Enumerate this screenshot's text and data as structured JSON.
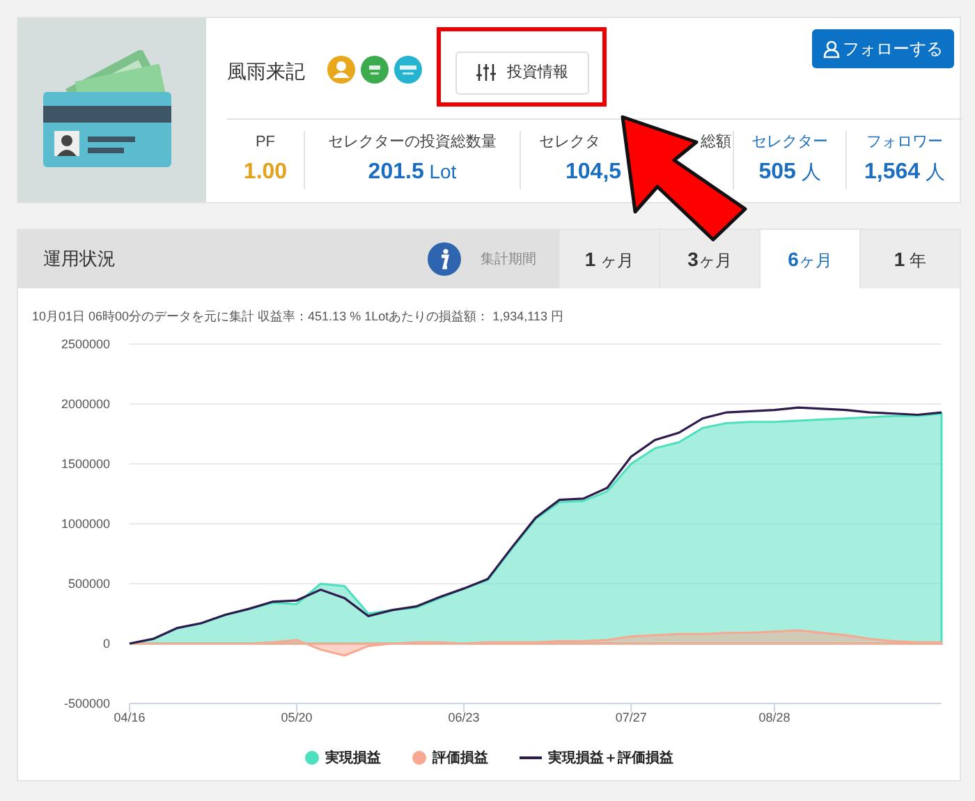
{
  "profile": {
    "name": "風雨来記",
    "badges": [
      {
        "kind": "avatar",
        "color": "#e8a81c"
      },
      {
        "kind": "popular",
        "color": "#3bab4e"
      },
      {
        "kind": "profit",
        "color": "#25b3cf"
      }
    ],
    "info_button": "投資情報",
    "follow_button": "フォローする",
    "stats": [
      {
        "label_parts": [
          "PF"
        ],
        "value": "1.00",
        "kind": "orange"
      },
      {
        "label_parts": [
          "セレクターの投資総数量"
        ],
        "value": "201.5",
        "unit": "Lot",
        "kind": "plain"
      },
      {
        "label_parts": [
          "セレクタ",
          "総額"
        ],
        "value": "104,5",
        "kind": "plain"
      },
      {
        "label_parts": [
          "セレクター"
        ],
        "value": "505",
        "unit": "人",
        "kind": "link"
      },
      {
        "label_parts": [
          "フォロワー"
        ],
        "value": "1,564",
        "unit": "人",
        "kind": "link"
      }
    ]
  },
  "performance": {
    "title": "運用状況",
    "period_label": "集計期間",
    "tabs": [
      {
        "label": "**1** ヶ月",
        "selected": false
      },
      {
        "label": "**3**ヶ月",
        "selected": false
      },
      {
        "label": "**6**ヶ月",
        "selected": true
      },
      {
        "label": "**1** 年",
        "selected": false
      }
    ],
    "summary": "10月01日 06時00分のデータを元に集計 収益率：451.13 % 1Lotあたりの損益額： 1,934,113 円",
    "chart_data": {
      "type": "area",
      "grid": true,
      "categories": [
        "04/16",
        null,
        null,
        null,
        null,
        null,
        null,
        "05/20",
        null,
        null,
        null,
        null,
        null,
        null,
        "06/23",
        null,
        null,
        null,
        null,
        null,
        null,
        "07/27",
        null,
        null,
        null,
        null,
        null,
        "08/28",
        null,
        null,
        null,
        null,
        null,
        null,
        null
      ],
      "ylim": [
        -500000,
        2500000
      ],
      "yticks": [
        -500000,
        0,
        500000,
        1000000,
        1500000,
        2000000,
        2500000
      ],
      "series": [
        {
          "name": "実現損益",
          "color": "#4ee0bd",
          "type": "area",
          "values": [
            0,
            40000,
            130000,
            170000,
            240000,
            290000,
            340000,
            330000,
            500000,
            480000,
            250000,
            280000,
            300000,
            380000,
            460000,
            530000,
            790000,
            1040000,
            1180000,
            1190000,
            1270000,
            1500000,
            1630000,
            1680000,
            1800000,
            1840000,
            1850000,
            1850000,
            1860000,
            1870000,
            1880000,
            1890000,
            1900000,
            1900000,
            1920000
          ]
        },
        {
          "name": "評価損益",
          "color": "#f7a891",
          "type": "area",
          "values": [
            0,
            0,
            0,
            0,
            0,
            0,
            10000,
            30000,
            -50000,
            -100000,
            -20000,
            0,
            10000,
            10000,
            0,
            10000,
            10000,
            10000,
            20000,
            20000,
            30000,
            60000,
            70000,
            80000,
            80000,
            90000,
            90000,
            100000,
            110000,
            90000,
            70000,
            40000,
            20000,
            10000,
            10000
          ]
        },
        {
          "name": "実現損益＋評価損益",
          "color": "#2d1b4e",
          "type": "line",
          "values": [
            0,
            40000,
            130000,
            170000,
            240000,
            290000,
            350000,
            360000,
            450000,
            380000,
            230000,
            280000,
            310000,
            390000,
            460000,
            540000,
            800000,
            1050000,
            1200000,
            1210000,
            1300000,
            1560000,
            1700000,
            1760000,
            1880000,
            1930000,
            1940000,
            1950000,
            1970000,
            1960000,
            1950000,
            1930000,
            1920000,
            1910000,
            1930000
          ]
        }
      ]
    }
  }
}
